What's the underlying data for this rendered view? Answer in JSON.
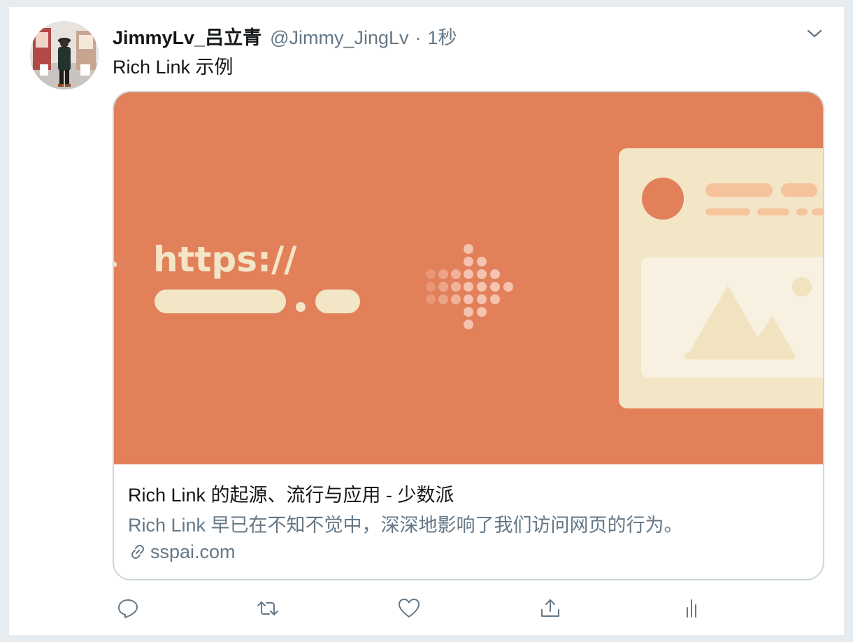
{
  "tweet": {
    "display_name": "JimmyLv_吕立青",
    "handle": "@Jimmy_JingLv",
    "separator": "·",
    "time": "1秒",
    "text": "Rich Link 示例"
  },
  "card": {
    "image_text": "https://",
    "title": "Rich Link 的起源、流行与应用 - 少数派",
    "description": "Rich Link 早已在不知不觉中，深深地影响了我们访问网页的行为。",
    "domain": "sspai.com",
    "image_colors": {
      "background": "#e2805a",
      "cream": "#f2e6c7",
      "light_orange": "#f5c49d"
    }
  },
  "actions": {
    "reply_icon": "reply-icon",
    "retweet_icon": "retweet-icon",
    "like_icon": "heart-icon",
    "share_icon": "share-icon",
    "analytics_icon": "analytics-icon"
  },
  "colors": {
    "primary_text": "#14171a",
    "secondary_text": "#657786",
    "border": "#ccd6dd",
    "page_bg": "#e6ecf0"
  }
}
